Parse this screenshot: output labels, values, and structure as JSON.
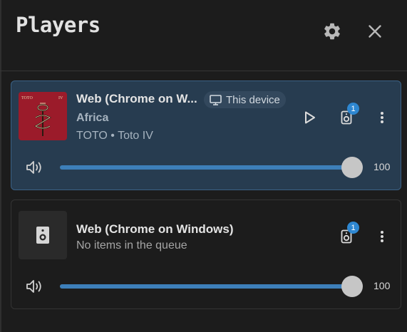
{
  "header": {
    "title": "Players",
    "settings_icon": "gear-icon",
    "close_icon": "close-icon"
  },
  "players": [
    {
      "name": "Web (Chrome on W...",
      "device_badge": "This device",
      "track": "Africa",
      "artist_album": "TOTO • Toto IV",
      "queue_count": "1",
      "volume": 100,
      "volume_label": "100",
      "album_art": {
        "top_left": "TOTO",
        "top_right": "IV"
      }
    },
    {
      "name": "Web (Chrome on Windows)",
      "queue_status": "No items in the queue",
      "queue_count": "1",
      "volume": 100,
      "volume_label": "100"
    }
  ],
  "colors": {
    "accent": "#3d7fb9",
    "active_card": "#273c50",
    "badge": "#2e87d1",
    "album_red": "#9b1b2a"
  }
}
